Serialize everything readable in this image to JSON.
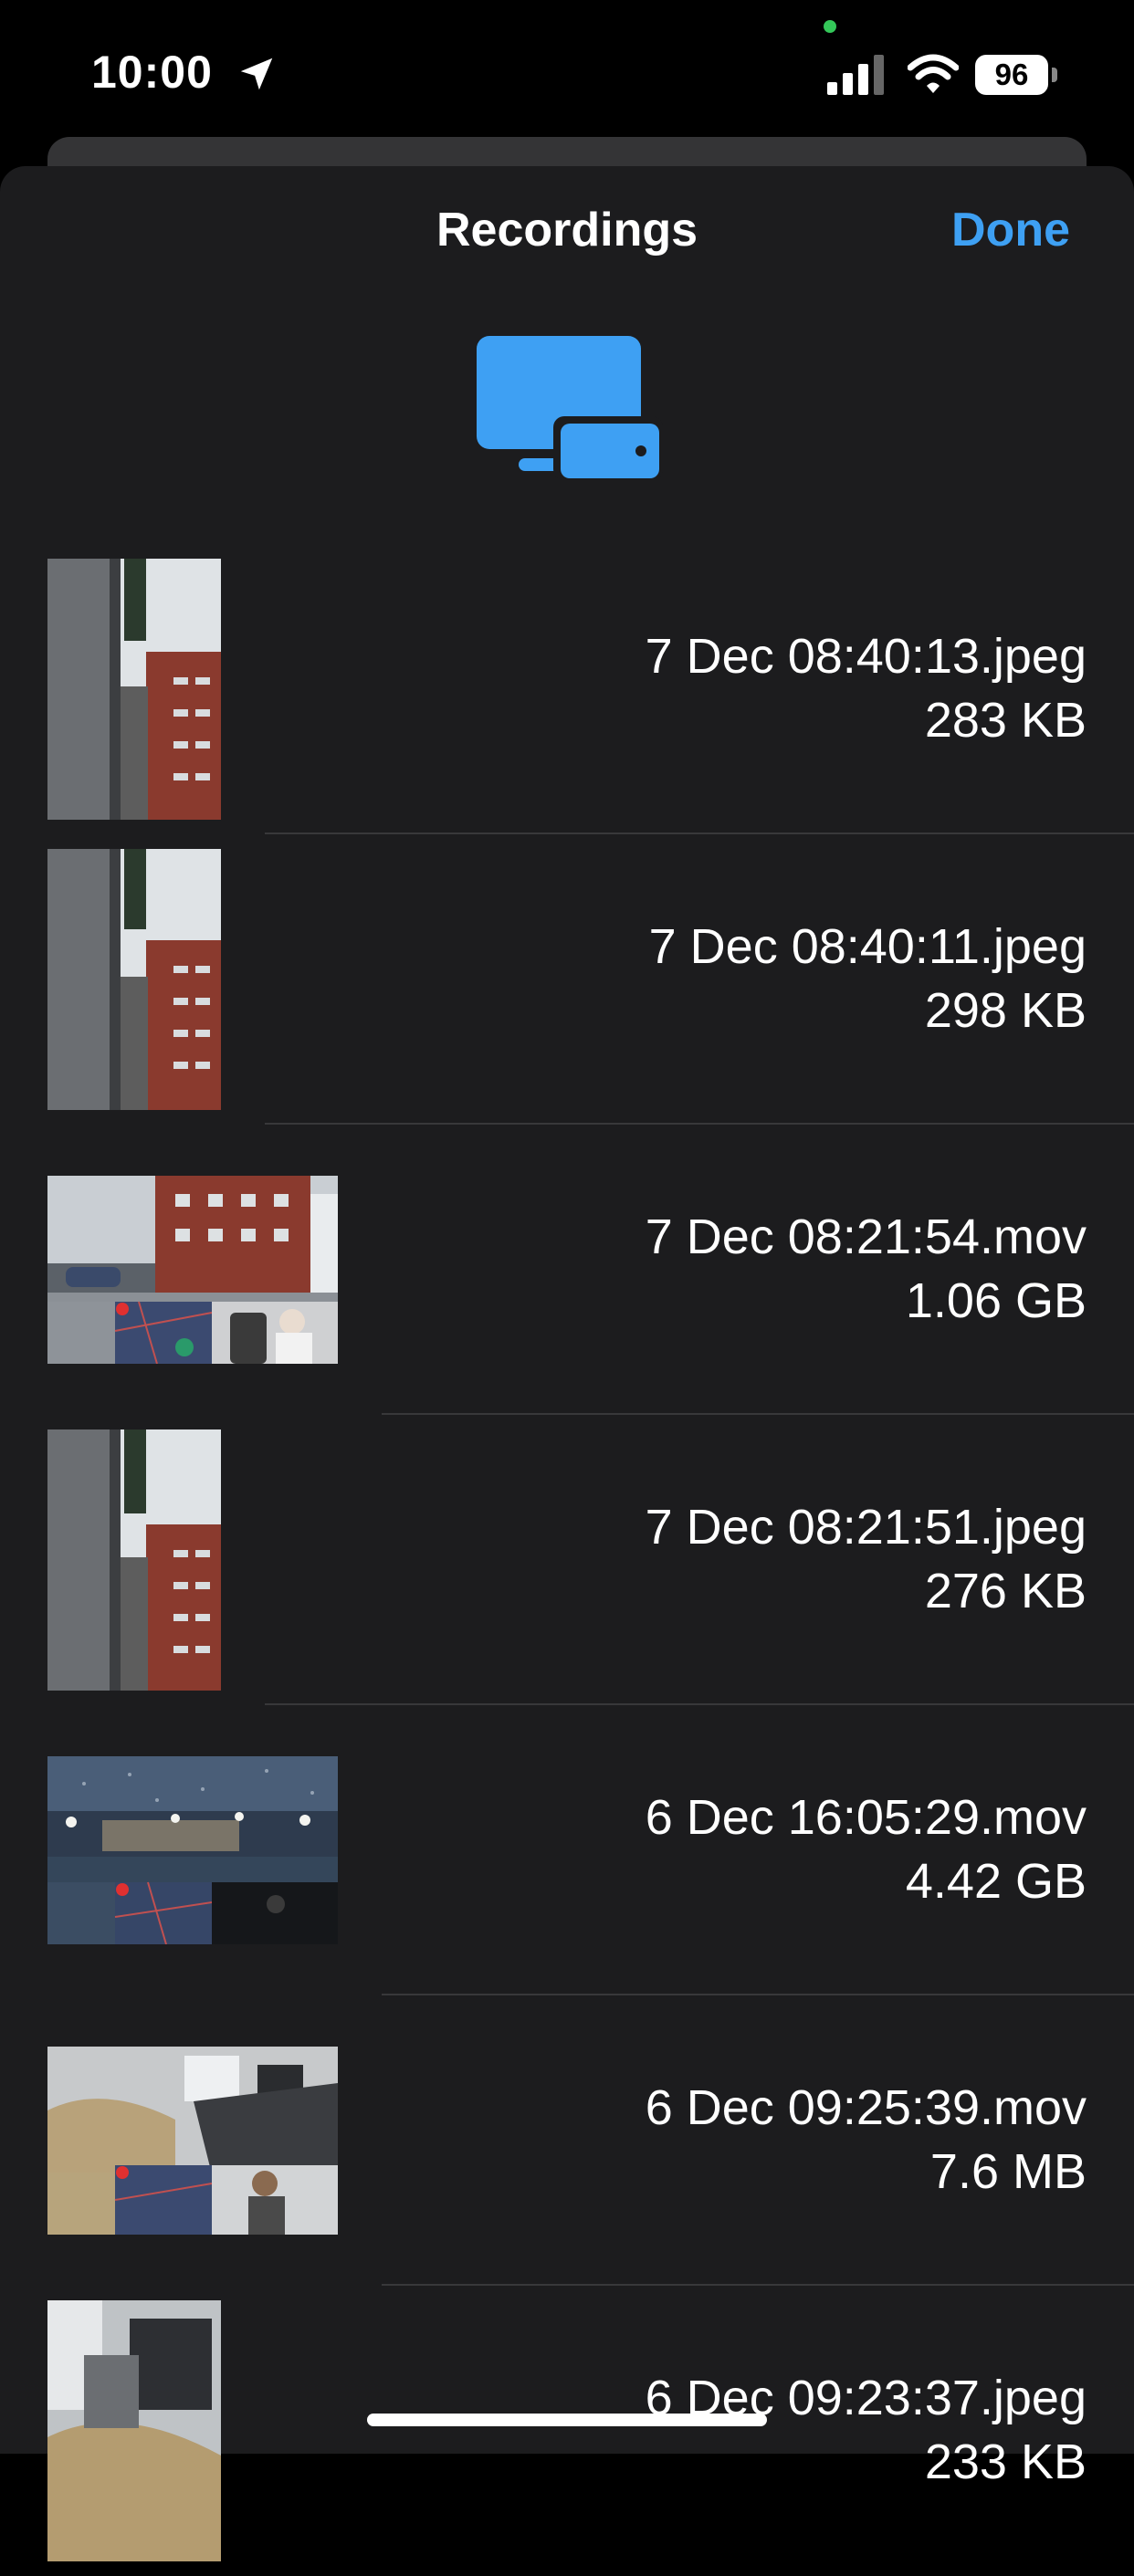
{
  "status_bar": {
    "time": "10:00",
    "battery": "96",
    "icons": [
      "location-arrow-icon",
      "signal-icon",
      "wifi-icon",
      "battery-icon"
    ]
  },
  "sheet": {
    "title": "Recordings",
    "done_label": "Done",
    "header_icon": "devices-icon",
    "accent_color": "#3ea0f3"
  },
  "files": [
    {
      "name": "7 Dec 08:40:13.jpeg",
      "size": "283 KB",
      "thumb": "portrait"
    },
    {
      "name": "7 Dec 08:40:11.jpeg",
      "size": "298 KB",
      "thumb": "portrait"
    },
    {
      "name": "7 Dec 08:21:54.mov",
      "size": "1.06 GB",
      "thumb": "landscape"
    },
    {
      "name": "7 Dec 08:21:51.jpeg",
      "size": "276 KB",
      "thumb": "portrait"
    },
    {
      "name": "6 Dec 16:05:29.mov",
      "size": "4.42 GB",
      "thumb": "landscape"
    },
    {
      "name": "6 Dec 09:25:39.mov",
      "size": "7.6 MB",
      "thumb": "landscape"
    },
    {
      "name": "6 Dec 09:23:37.jpeg",
      "size": "233 KB",
      "thumb": "portrait"
    }
  ]
}
